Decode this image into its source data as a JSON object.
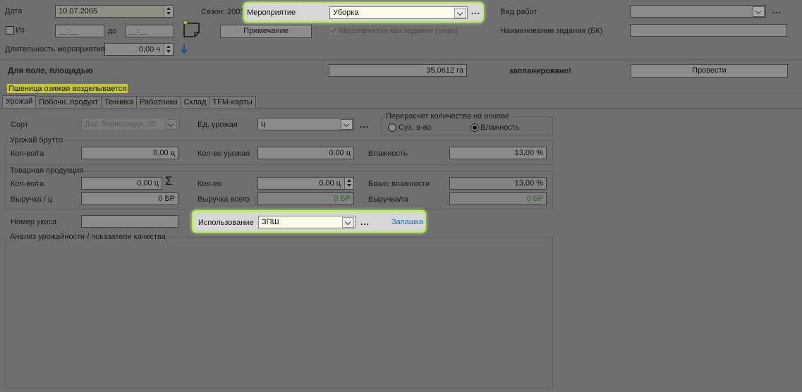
{
  "header": {
    "date_label": "Дата",
    "date_value": "10.07.2005",
    "from_label": "Из",
    "from_value": "__:__",
    "to_label": "до",
    "to_value": "__:__",
    "duration_label": "Длительность мероприятия",
    "duration_value": "0,00 ч",
    "season_label": "Сезон: 2005",
    "event_label": "Мероприятие",
    "event_value": "Уборка",
    "more": "...",
    "note_button": "Примечание",
    "as_task_label": "Мероприятие как задание (план)",
    "work_type_label": "Вид работ",
    "work_type_value": "",
    "task_name_label": "Наименование задания (БК)",
    "task_name_value": ""
  },
  "field_info": {
    "title": "Для поле, площадью",
    "area_value": "35,0612 га",
    "status": "запланировано!",
    "post_button": "Провести",
    "crop": "Пшеница озимая возделывается"
  },
  "tabs": [
    "Урожай",
    "Побочн. продукт",
    "Техника",
    "Работники",
    "Склад",
    "TFM-карты"
  ],
  "harvest": {
    "variety_label": "Сорт",
    "variety_value": "Дар Зернограда, 00",
    "unit_label": "Ед. урожая",
    "unit_value": "ц",
    "recalc_title": "Перерасчет количества на основе",
    "recalc_options": [
      "Сух. в-во",
      "Влажность"
    ],
    "recalc_selected": "Влажность",
    "gross": {
      "title": "Урожай брутто",
      "qty_ha_label": "Кол-во/га",
      "qty_ha_value": "0,00 ц",
      "qty_label": "Кол-во урожая",
      "qty_value": "0,00 ц",
      "moisture_label": "Влажность",
      "moisture_value": "13,00 %"
    },
    "commercial": {
      "title": "Товарная продукция",
      "qty_ha_label": "Кол-во/га",
      "qty_ha_value": "0,00 ц",
      "sum_symbol": "Σ",
      "qty_label": "Кол-во",
      "qty_value": "0,00 ц",
      "base_moisture_label": "Базис влажности",
      "base_moisture_value": "13,00 %",
      "revenue_unit_label": "Выручка / ц",
      "revenue_unit_value": "0 БР",
      "revenue_total_label": "Выручка всего",
      "revenue_total_value": "0 БР",
      "revenue_ha_label": "Выручка/га",
      "revenue_ha_value": "0 БР"
    },
    "mowing_label": "Номер укоса",
    "mowing_value": "",
    "usage_label": "Использование",
    "usage_value": "ЗПШ",
    "usage_more": "...",
    "usage_link": "Запашка",
    "analysis_title": "Анализ урожайности / показатели качества"
  }
}
